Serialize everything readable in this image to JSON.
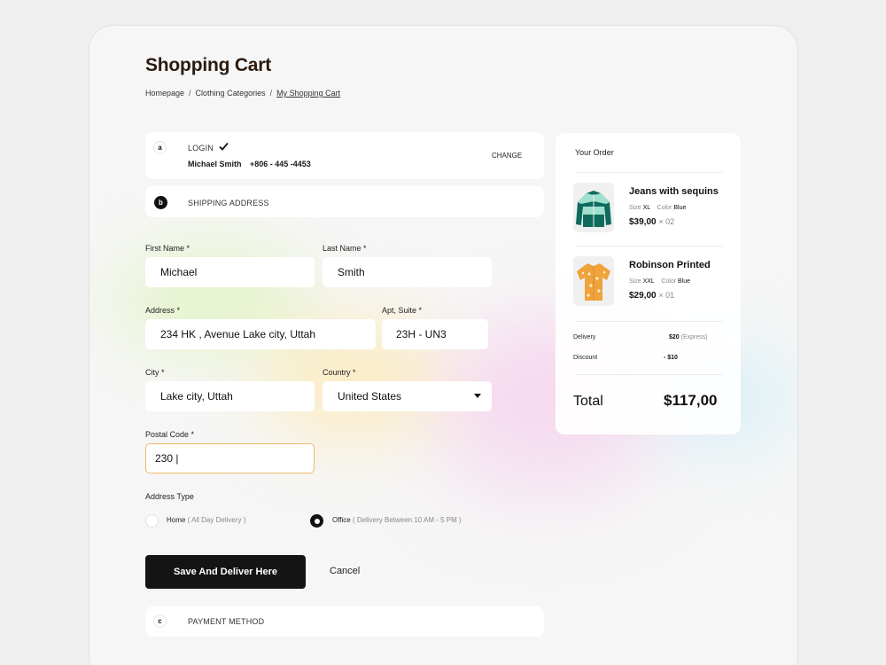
{
  "page": {
    "title": "Shopping Cart",
    "breadcrumb": [
      "Homepage",
      "Clothing Categories",
      "My Shopping Cart"
    ]
  },
  "steps": {
    "login": {
      "letter": "a",
      "label": "LOGIN",
      "completed": true,
      "name": "Michael Smith",
      "phone": "+806 - 445 -4453",
      "change_label": "CHANGE"
    },
    "shipping": {
      "letter": "b",
      "label": "SHIPPING ADDRESS"
    },
    "payment": {
      "letter": "c",
      "label": "PAYMENT METHOD"
    }
  },
  "form": {
    "first_name": {
      "label": "First Name *",
      "value": "Michael"
    },
    "last_name": {
      "label": "Last Name *",
      "value": "Smith"
    },
    "address": {
      "label": "Address *",
      "value": "234 HK , Avenue Lake city, Uttah"
    },
    "apt": {
      "label": "Apt, Suite *",
      "value": "23H - UN3"
    },
    "city": {
      "label": "City *",
      "value": "Lake city, Uttah"
    },
    "country": {
      "label": "Country *",
      "value": "United States"
    },
    "postal": {
      "label": "Postal Code *",
      "value": "230 |"
    },
    "address_type": {
      "label": "Address Type",
      "options": [
        {
          "name": "Home",
          "note": "( All Day Delivery )",
          "selected": false
        },
        {
          "name": "Office",
          "note": "( Delivery Between 10 AM - 5 PM )",
          "selected": true
        }
      ]
    },
    "save_label": "Save And Deliver Here",
    "cancel_label": "Cancel"
  },
  "order": {
    "title": "Your Order",
    "items": [
      {
        "name": "Jeans with sequins",
        "size_label": "Size",
        "size": "XL",
        "color_label": "Color",
        "color": "Blue",
        "price": "$39,00",
        "qty": "× 02",
        "thumb_icon": "track-jacket-icon"
      },
      {
        "name": "Robinson Printed",
        "size_label": "Size",
        "size": "XXL",
        "color_label": "Color",
        "color": "Blue",
        "price": "$29,00",
        "qty": "× 01",
        "thumb_icon": "printed-shirt-icon"
      }
    ],
    "delivery_label": "Delivery",
    "delivery_value": "$20",
    "delivery_note": "(Express)",
    "discount_label": "Discount",
    "discount_value": "- $10",
    "total_label": "Total",
    "total_value": "$117,00"
  },
  "colors": {
    "accent_dark": "#141414",
    "title_brown": "#2b1a0e",
    "focus_border": "#efb86a",
    "jacket_green": "#0f6b5c",
    "shirt_orange": "#f0a23c"
  }
}
